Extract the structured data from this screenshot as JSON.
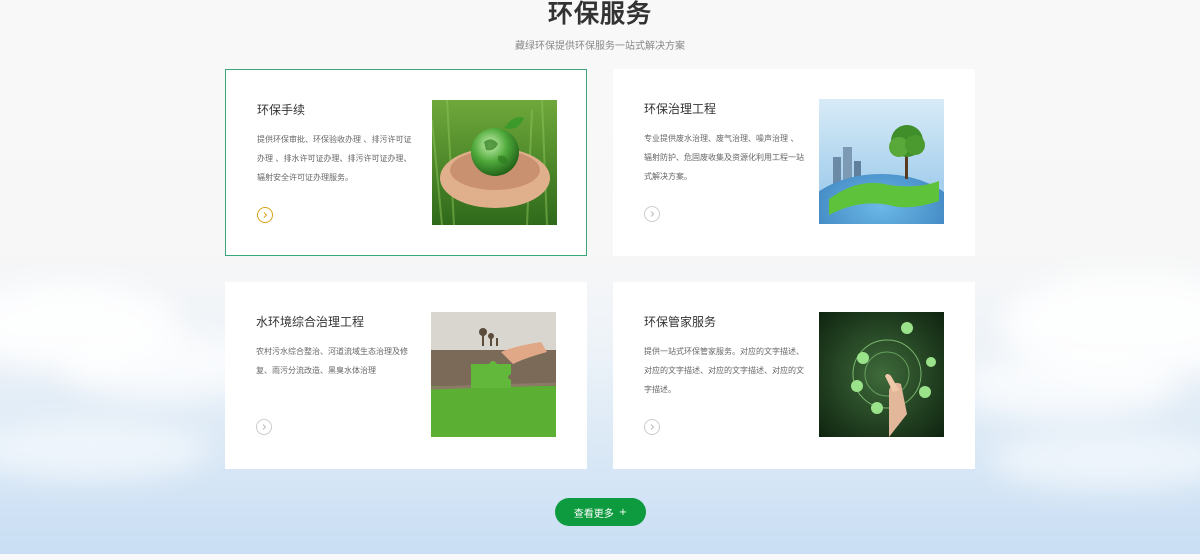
{
  "section": {
    "title": "环保服务",
    "subtitle": "藏绿环保提供环保服务一站式解决方案"
  },
  "services": [
    {
      "title": "环保手续",
      "description": "提供环保审批、环保验收办理 、排污许可证办理 、排水许可证办理、排污许可证办理、辐射安全许可证办理服务。",
      "icon": "chevron-right-icon",
      "image": "hands-holding-globe"
    },
    {
      "title": "环保治理工程",
      "description": "专业提供废水治理、废气治理、噪声治理 、辐射防护、危固废收集及资源化利用工程一站式解决方案。",
      "icon": "chevron-right-icon",
      "image": "earth-with-city-and-tree"
    },
    {
      "title": "水环境综合治理工程",
      "description": "农村污水综合整治、河道流域生态治理及修复、雨污分流改造、黑臭水体治理",
      "icon": "chevron-right-icon",
      "image": "grass-puzzle-over-dry-land"
    },
    {
      "title": "环保管家服务",
      "description": "提供一站式环保管家服务。对应的文字描述、对应的文字描述、对应的文字描述、对应的文字描述。",
      "icon": "chevron-right-icon",
      "image": "hand-touching-eco-icons"
    }
  ],
  "more_button": {
    "label": "查看更多",
    "icon": "+"
  },
  "colors": {
    "accent_green": "#0e9a3e",
    "active_border": "#3aa77a",
    "arrow_active": "#d9a21b"
  }
}
